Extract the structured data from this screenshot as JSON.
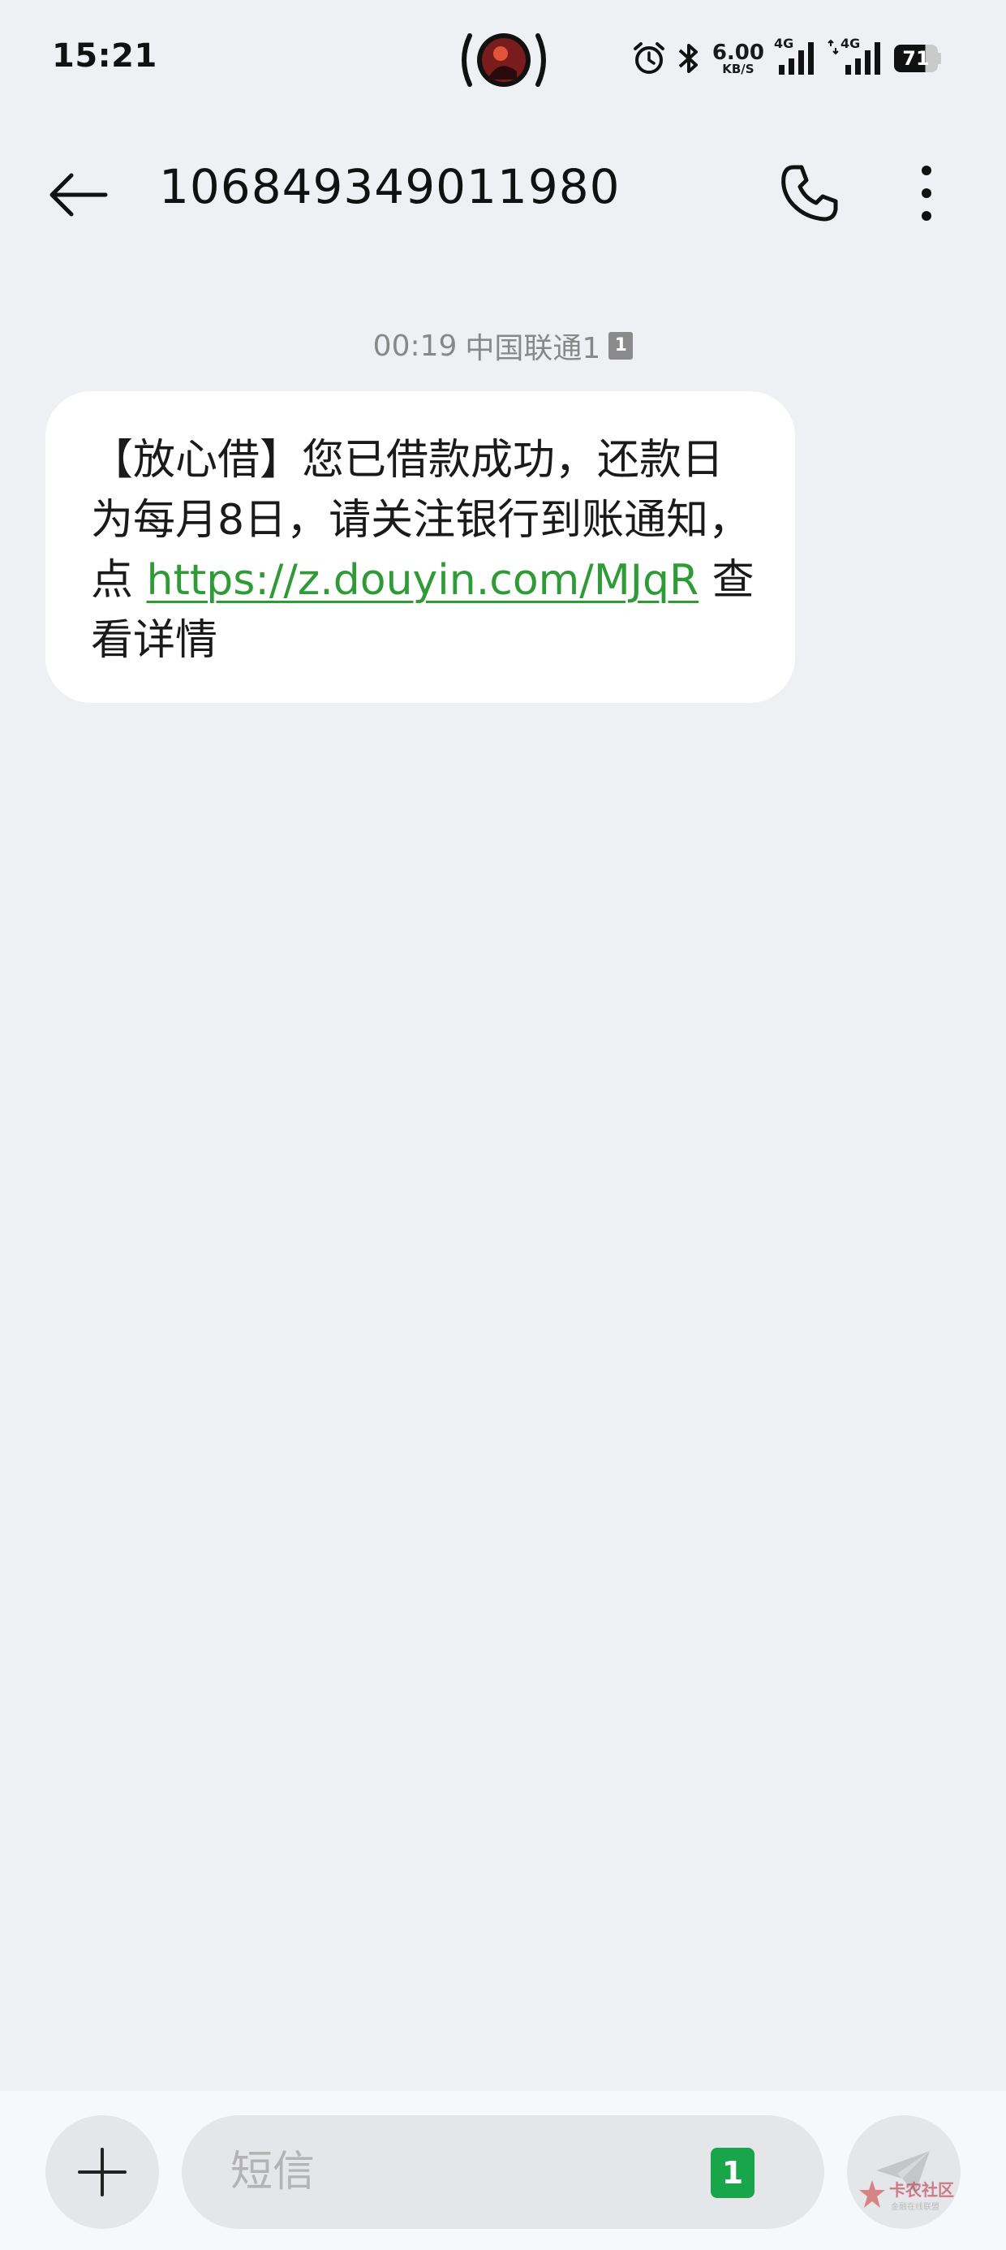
{
  "status_bar": {
    "time": "15:21",
    "network_speed": "6.00",
    "network_speed_unit": "KB/S",
    "network_type_1": "4G",
    "network_type_2": "4G",
    "battery_level": "71",
    "icons": [
      "alarm-icon",
      "bluetooth-icon",
      "signal-icon",
      "signal-icon",
      "battery-icon"
    ]
  },
  "header": {
    "title": "106849349011980",
    "icons": [
      "back-arrow-icon",
      "phone-icon",
      "more-vertical-icon"
    ]
  },
  "conversation": {
    "meta_time": "00:19",
    "meta_carrier": "中国联通1",
    "meta_sim": "1",
    "message": {
      "text_before_link": "【放心借】您已借款成功，还款日为每月8日，请关注银行到账通知，点 ",
      "link": "https://z.douyin.com/MJqR",
      "text_after_link": " 查看详情"
    }
  },
  "compose": {
    "placeholder": "短信",
    "sim_slot": "1",
    "icons": [
      "plus-icon",
      "send-icon"
    ]
  },
  "watermark": {
    "text": "卡农社区",
    "subtext": "金融在线联盟"
  },
  "colors": {
    "background": "#eef0f3",
    "link": "#2e9b37",
    "sim_badge_green": "#19a64a"
  }
}
